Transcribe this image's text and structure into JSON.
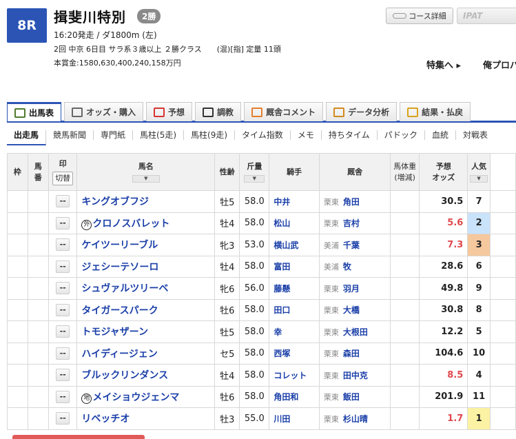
{
  "race": {
    "number": "8R",
    "name": "揖斐川特別",
    "grade": "2勝",
    "info1": "16:20発走 / ダ1800m (左)",
    "info2": "2回 中京 6日目 サラ系３歳以上 ２勝クラス　　(混)[指] 定量 11頭",
    "prize": "本賞金:1580,630,400,240,158万円"
  },
  "header_links": {
    "course": "コース詳細",
    "ipat": "IPAT",
    "tokushu": "特集へ ▸",
    "ore": "俺プロパ"
  },
  "tabs": [
    {
      "label": "出馬表",
      "icon": "table-icon",
      "color": "#4f7a2e"
    },
    {
      "label": "オッズ・購入",
      "icon": "odds-icon",
      "color": "#666"
    },
    {
      "label": "予想",
      "icon": "target-icon",
      "color": "#d73434"
    },
    {
      "label": "調教",
      "icon": "stopwatch-icon",
      "color": "#333"
    },
    {
      "label": "厩舎コメント",
      "icon": "stable-icon",
      "color": "#e57e2a"
    },
    {
      "label": "データ分析",
      "icon": "barchart-icon",
      "color": "#d28a1c"
    },
    {
      "label": "結果・払戻",
      "icon": "coins-icon",
      "color": "#d8a21c"
    }
  ],
  "subnav": [
    "出走馬",
    "競馬新聞",
    "専門紙",
    "馬柱(5走)",
    "馬柱(9走)",
    "タイム指数",
    "メモ",
    "持ちタイム",
    "パドック",
    "血統",
    "対戦表"
  ],
  "table": {
    "headers": {
      "waku": "枠",
      "umaban": "馬\n番",
      "mark": "印",
      "mark_btn": "切替",
      "name": "馬名",
      "sexage": "性齢",
      "weight": "斤量",
      "jockey": "騎手",
      "stable": "厩舎",
      "bodyweight": "馬体重\n(増減)",
      "odds": "予想\nオッズ",
      "pop": "人気",
      "sort": "▼"
    },
    "mark_value": "--",
    "rows": [
      {
        "name": "キングオブフジ",
        "prefix": "",
        "sexage": "牡5",
        "weight": "58.0",
        "jockey": "中井",
        "region": "栗東",
        "trainer": "角田",
        "odds": "30.5",
        "pop": "7"
      },
      {
        "name": "クロノスバレット",
        "prefix": "外",
        "sexage": "牡4",
        "weight": "58.0",
        "jockey": "松山",
        "region": "栗東",
        "trainer": "吉村",
        "odds": "5.6",
        "pop": "2"
      },
      {
        "name": "ケイツーリーブル",
        "prefix": "",
        "sexage": "牝3",
        "weight": "53.0",
        "jockey": "横山武",
        "region": "美浦",
        "trainer": "千葉",
        "odds": "7.3",
        "pop": "3"
      },
      {
        "name": "ジェシーテソーロ",
        "prefix": "",
        "sexage": "牡4",
        "weight": "58.0",
        "jockey": "富田",
        "region": "美浦",
        "trainer": "牧",
        "odds": "28.6",
        "pop": "6"
      },
      {
        "name": "シュヴァルツリーベ",
        "prefix": "",
        "sexage": "牝6",
        "weight": "56.0",
        "jockey": "藤懸",
        "region": "栗東",
        "trainer": "羽月",
        "odds": "49.8",
        "pop": "9"
      },
      {
        "name": "タイガースパーク",
        "prefix": "",
        "sexage": "牡6",
        "weight": "58.0",
        "jockey": "田口",
        "region": "栗東",
        "trainer": "大橋",
        "odds": "30.8",
        "pop": "8"
      },
      {
        "name": "トモジャザーン",
        "prefix": "",
        "sexage": "牡5",
        "weight": "58.0",
        "jockey": "幸",
        "region": "栗東",
        "trainer": "大根田",
        "odds": "12.2",
        "pop": "5"
      },
      {
        "name": "ハイディージェン",
        "prefix": "",
        "sexage": "セ5",
        "weight": "58.0",
        "jockey": "西塚",
        "region": "栗東",
        "trainer": "森田",
        "odds": "104.6",
        "pop": "10"
      },
      {
        "name": "ブルックリンダンス",
        "prefix": "",
        "sexage": "牡4",
        "weight": "58.0",
        "jockey": "コレット",
        "region": "栗東",
        "trainer": "田中克",
        "odds": "8.5",
        "pop": "4"
      },
      {
        "name": "メイショウジェンマ",
        "prefix": "地",
        "sexage": "牡6",
        "weight": "58.0",
        "jockey": "角田和",
        "region": "栗東",
        "trainer": "飯田",
        "odds": "201.9",
        "pop": "11"
      },
      {
        "name": "リベッチオ",
        "prefix": "",
        "sexage": "牡3",
        "weight": "55.0",
        "jockey": "川田",
        "region": "栗東",
        "trainer": "杉山晴",
        "odds": "1.7",
        "pop": "1"
      }
    ]
  },
  "colors": {
    "accent": "#2b54b5",
    "link": "#1a3fa8",
    "hot_odds": "#e0474c",
    "pop1": "#fcf2a4",
    "pop2": "#c9e3fb",
    "pop3": "#f6c89e"
  }
}
